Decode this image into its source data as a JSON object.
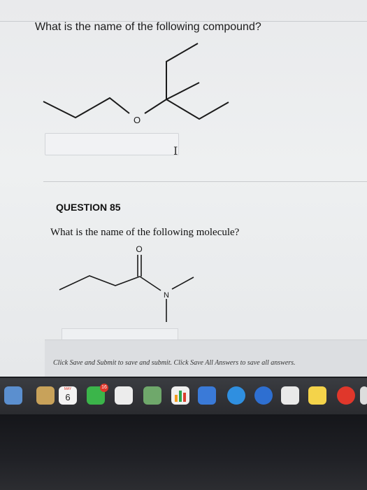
{
  "question_top": {
    "prompt": "What is the name of the following compound?",
    "oxygen_label": "O"
  },
  "question_85": {
    "number_label": "QUESTION 85",
    "prompt": "What is the name of the following molecule?",
    "carbonyl_oxygen_label": "O",
    "nitrogen_label": "N"
  },
  "footer": {
    "instruction": "Click Save and Submit to save and submit. Click Save All Answers to save all answers."
  },
  "dock": {
    "calendar_day": "6",
    "calendar_month": "MAY",
    "facetime_badge": "16"
  }
}
